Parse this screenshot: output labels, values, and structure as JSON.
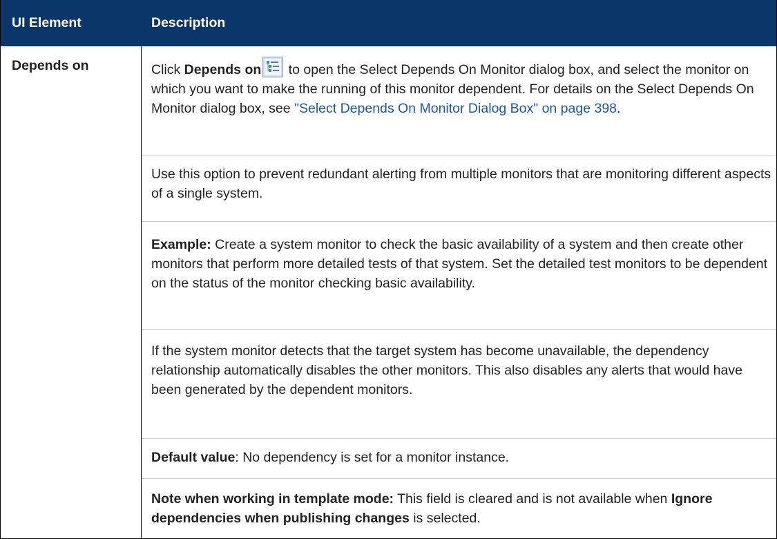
{
  "header": {
    "col1": "UI Element",
    "col2": "Description"
  },
  "row": {
    "label": "Depends on",
    "p1": {
      "pre": "Click ",
      "bold": "Depends on",
      "post": " to open the Select Depends On Monitor dialog box, and select the monitor on which you want to make the running of this monitor dependent. For details on the Select Depends On Monitor dialog box, see ",
      "link": "\"Select Depends On Monitor Dialog Box\" on page 398",
      "end": "."
    },
    "p2": "Use this option to prevent redundant alerting from multiple monitors that are monitoring different aspects of a single system.",
    "p3": {
      "bold": "Example:",
      "text": " Create a system monitor to check the basic availability of a system and then create other monitors that perform more detailed tests of that system. Set the detailed test monitors to be dependent on the status of the monitor checking basic availability."
    },
    "p4": "If the system monitor detects that the target system has become unavailable, the dependency relationship automatically disables the other monitors. This also disables any alerts that would have been generated by the dependent monitors.",
    "p5": {
      "bold": "Default value",
      "text": ": No dependency is set for a monitor instance."
    },
    "p6": {
      "bold": "Note when working in template mode:",
      "text": " This field is cleared and is not available when ",
      "bold2": "Ignore dependencies when publishing changes",
      "end": " is selected."
    }
  },
  "icons": {
    "depends_on": "depends-on-icon"
  },
  "colors": {
    "header_bg": "#0a3669",
    "link": "#1a56a8"
  }
}
